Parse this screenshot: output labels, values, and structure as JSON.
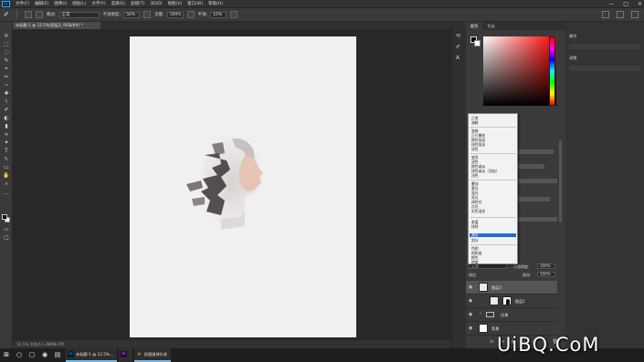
{
  "app": {
    "logo_text": "Ps"
  },
  "menubar": {
    "items": [
      "文件(F)",
      "编辑(E)",
      "图像(I)",
      "图层(L)",
      "文字(Y)",
      "选择(S)",
      "滤镜(T)",
      "3D(D)",
      "视图(V)",
      "窗口(W)",
      "帮助(H)"
    ],
    "window_controls": [
      "—",
      "□",
      "✕"
    ]
  },
  "options": {
    "mode_label": "模式:",
    "mode_value": "正常",
    "opacity_label": "不透明度:",
    "opacity_value": "50%",
    "flow_label": "流量:",
    "flow_value": "100%",
    "smooth_label": "平滑:",
    "smooth_value": "10%"
  },
  "document": {
    "tab_title": "未标题-1 @ 12.5%(图层3, RGB/8#) *",
    "status_text": "12.5%      文档:11.3M/88.7M"
  },
  "toolbar": {
    "tools": [
      "✛",
      "⬚",
      "◌",
      "✎",
      "⌖",
      "✂",
      "⌁",
      "✚",
      "⌇",
      "✐",
      "◐",
      "▮",
      "⟡",
      "✦",
      "T",
      "↖",
      "▭",
      "✋",
      "⌕",
      "···"
    ]
  },
  "color_panel": {
    "tabs": [
      "颜色",
      "色板"
    ]
  },
  "blend_dropdown": {
    "groups": [
      [
        "正常",
        "溶解"
      ],
      [
        "变暗",
        "正片叠底",
        "颜色加深",
        "线性加深",
        "深色"
      ],
      [
        "变亮",
        "滤色",
        "颜色减淡",
        "线性减淡（添加）",
        "浅色"
      ],
      [
        "叠加",
        "柔光",
        "强光",
        "亮光",
        "线性光",
        "点光",
        "实色混合"
      ],
      [
        "差值",
        "排除",
        "减去",
        "划分"
      ],
      [
        "色相",
        "饱和度",
        "颜色",
        "明度"
      ]
    ],
    "selected": "减去"
  },
  "layers_panel": {
    "blend_mode": "正常",
    "opacity_label": "不透明度:",
    "opacity_value": "100%",
    "lock_label": "锁定:",
    "fill_label": "填充:",
    "fill_value": "100%",
    "layers": [
      {
        "name": "图层3",
        "type": "pixel",
        "active": true
      },
      {
        "name": "图层1",
        "type": "masked",
        "active": false
      },
      {
        "name": "风景",
        "type": "group",
        "active": false
      },
      {
        "name": "背景",
        "type": "background",
        "active": false
      }
    ],
    "footer_icons": [
      "⊖",
      "fx",
      "◑",
      "◐",
      "▭",
      "+",
      "🗑"
    ]
  },
  "right_column": {
    "items": [
      "属性",
      "调整"
    ]
  },
  "taskbar": {
    "start_glyph": "⊞",
    "buttons": [
      "○",
      "▢",
      "◉",
      "▤"
    ],
    "apps": [
      {
        "icon": "Ps",
        "label": "未标题-1 @ 12.5%..."
      },
      {
        "icon": "Pr",
        "label": ""
      },
      {
        "icon": "▤",
        "label": "抠图毁掉头发"
      }
    ]
  },
  "watermark": "UiBQ.CoM"
}
